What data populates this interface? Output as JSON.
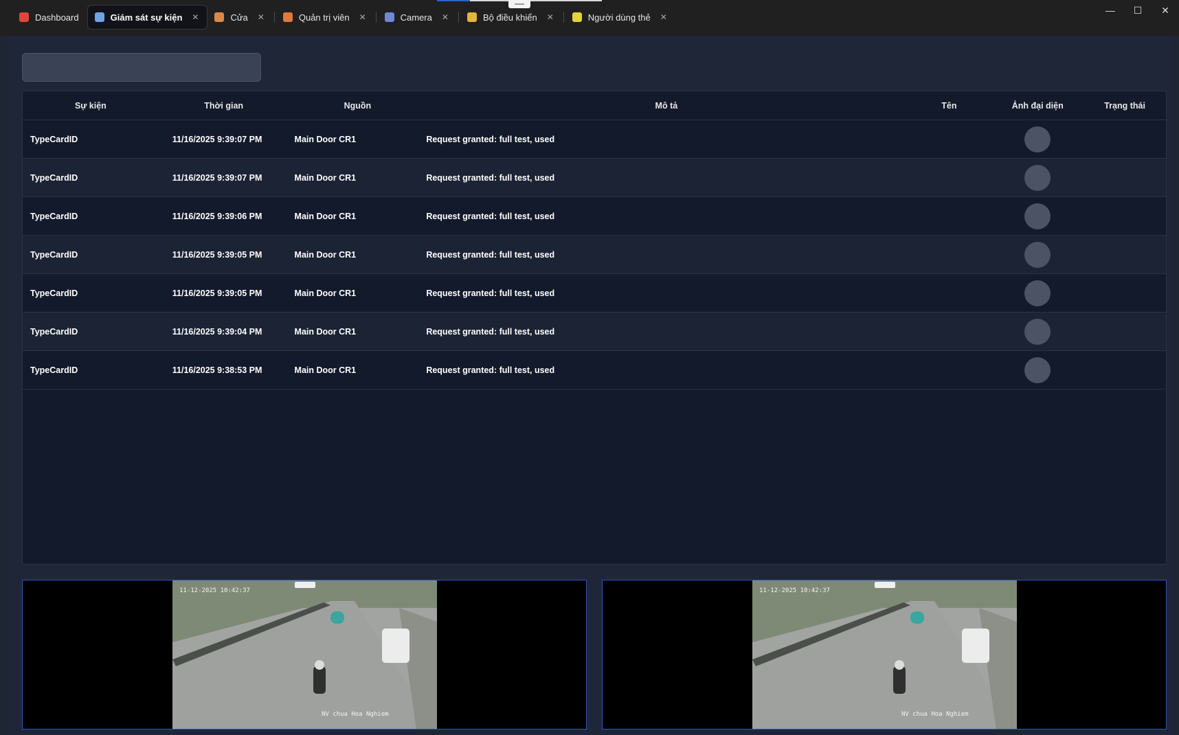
{
  "tabs": [
    {
      "label": "Dashboard",
      "icon": "dashboard-icon",
      "color": "#e0463a",
      "closable": false,
      "active": false
    },
    {
      "label": "Giám sát sự kiện",
      "icon": "monitor-events-icon",
      "color": "#6fa3e6",
      "closable": true,
      "active": true
    },
    {
      "label": "Cửa",
      "icon": "door-icon",
      "color": "#d98a4a",
      "closable": true,
      "active": false
    },
    {
      "label": "Quản trị viên",
      "icon": "admin-icon",
      "color": "#e07a3a",
      "closable": true,
      "active": false
    },
    {
      "label": "Camera",
      "icon": "camera-flag-icon",
      "color": "#6f87d6",
      "closable": true,
      "active": false
    },
    {
      "label": "Bộ điều khiển",
      "icon": "controller-icon",
      "color": "#e6b43a",
      "closable": true,
      "active": false
    },
    {
      "label": "Người dùng thẻ",
      "icon": "card-user-icon",
      "color": "#e6d23a",
      "closable": true,
      "active": false
    }
  ],
  "search": {
    "placeholder": ""
  },
  "table": {
    "headers": [
      "Sự kiện",
      "Thời gian",
      "Nguồn",
      "Mô tả",
      "Tên",
      "Ảnh đại diện",
      "Trạng thái"
    ],
    "rows": [
      {
        "event": "TypeCardID",
        "time": "11/16/2025 9:39:07 PM",
        "source": "Main Door CR1",
        "desc": "Request granted: full test, used",
        "name": "",
        "status": ""
      },
      {
        "event": "TypeCardID",
        "time": "11/16/2025 9:39:07 PM",
        "source": "Main Door CR1",
        "desc": "Request granted: full test, used",
        "name": "",
        "status": ""
      },
      {
        "event": "TypeCardID",
        "time": "11/16/2025 9:39:06 PM",
        "source": "Main Door CR1",
        "desc": "Request granted: full test, used",
        "name": "",
        "status": ""
      },
      {
        "event": "TypeCardID",
        "time": "11/16/2025 9:39:05 PM",
        "source": "Main Door CR1",
        "desc": "Request granted: full test, used",
        "name": "",
        "status": ""
      },
      {
        "event": "TypeCardID",
        "time": "11/16/2025 9:39:05 PM",
        "source": "Main Door CR1",
        "desc": "Request granted: full test, used",
        "name": "",
        "status": ""
      },
      {
        "event": "TypeCardID",
        "time": "11/16/2025 9:39:04 PM",
        "source": "Main Door CR1",
        "desc": "Request granted: full test, used",
        "name": "",
        "status": ""
      },
      {
        "event": "TypeCardID",
        "time": "11/16/2025 9:38:53 PM",
        "source": "Main Door CR1",
        "desc": "Request granted: full test, used",
        "name": "",
        "status": ""
      }
    ]
  },
  "cameras": [
    {
      "overlay_time": "11-12-2025 10:42:37",
      "caption": "NV chua Hoa Nghiem"
    },
    {
      "overlay_time": "11-12-2025 10:42:37",
      "caption": "NV chua Hoa Nghiem"
    }
  ],
  "window_controls": {
    "minimize": "—",
    "maximize": "☐",
    "close": "✕"
  }
}
